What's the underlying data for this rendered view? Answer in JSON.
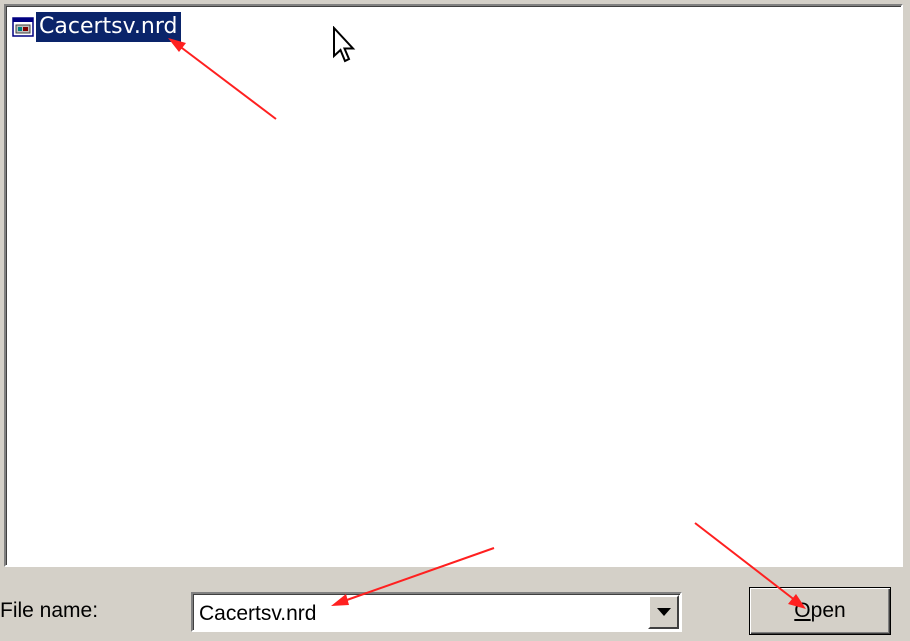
{
  "file_list": {
    "items": [
      {
        "label": "Cacertsv.nrd",
        "selected": true,
        "icon": "nrd-file-icon"
      }
    ]
  },
  "file_name": {
    "label": "File name:",
    "value": "Cacertsv.nrd"
  },
  "buttons": {
    "open_first": "O",
    "open_rest": "pen"
  },
  "colors": {
    "selection": "#0a246a",
    "annotation": "#ff2020",
    "dialog_bg": "#d4d0c8"
  }
}
